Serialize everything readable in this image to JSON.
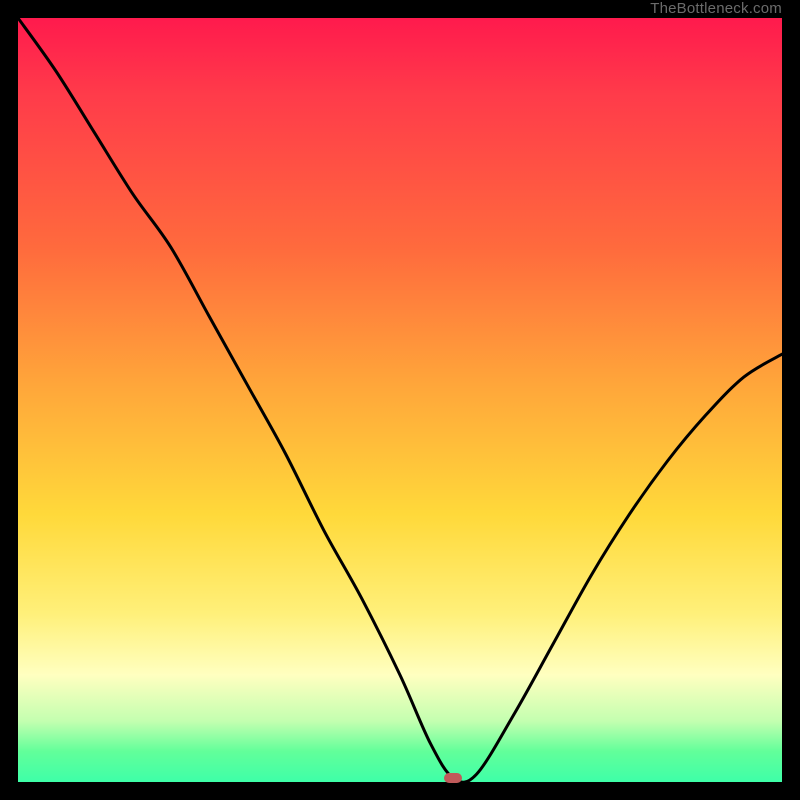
{
  "watermark": "TheBottleneck.com",
  "colors": {
    "frame": "#000000",
    "curve_stroke": "#000000",
    "marker": "#c05a5a"
  },
  "chart_data": {
    "type": "line",
    "title": "",
    "xlabel": "",
    "ylabel": "",
    "xlim": [
      0,
      100
    ],
    "ylim": [
      0,
      100
    ],
    "grid": false,
    "legend": false,
    "x": [
      0,
      5,
      10,
      15,
      20,
      25,
      30,
      35,
      40,
      45,
      50,
      54,
      57,
      60,
      65,
      70,
      75,
      80,
      85,
      90,
      95,
      100
    ],
    "values": [
      100,
      93,
      85,
      77,
      70,
      61,
      52,
      43,
      33,
      24,
      14,
      5,
      0.5,
      1,
      9,
      18,
      27,
      35,
      42,
      48,
      53,
      56
    ],
    "marker": {
      "x": 57,
      "y": 0.5
    },
    "flat_before_marker": [
      54,
      57
    ],
    "note": "Values read as percent of plot height from bottom; curve descends steeply from top-left, flattens briefly at the marker near bottom, then rises toward mid-right."
  }
}
